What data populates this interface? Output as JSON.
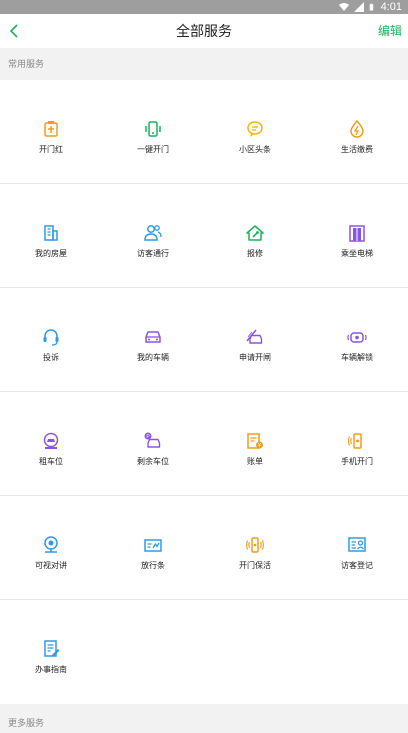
{
  "status_bar": {
    "time": "4:01"
  },
  "nav": {
    "title": "全部服务",
    "edit": "编辑"
  },
  "sections": {
    "common": "常用服务",
    "more": "更多服务"
  },
  "services": [
    {
      "label": "开门红",
      "icon": "gift-door-icon",
      "color": "#f39b1b"
    },
    {
      "label": "一键开门",
      "icon": "phone-door-icon",
      "color": "#19b35a"
    },
    {
      "label": "小区头条",
      "icon": "news-bubble-icon",
      "color": "#f5b400"
    },
    {
      "label": "生活缴费",
      "icon": "lightning-drop-icon",
      "color": "#f39b1b"
    },
    {
      "label": "我的房屋",
      "icon": "building-icon",
      "color": "#2e9be6"
    },
    {
      "label": "访客通行",
      "icon": "visitors-icon",
      "color": "#2e9be6"
    },
    {
      "label": "报修",
      "icon": "house-wrench-icon",
      "color": "#19b35a"
    },
    {
      "label": "乘坐电梯",
      "icon": "elevator-icon",
      "color": "#8a55e6"
    },
    {
      "label": "投诉",
      "icon": "headset-icon",
      "color": "#2e9be6"
    },
    {
      "label": "我的车辆",
      "icon": "car-icon",
      "color": "#8a55e6"
    },
    {
      "label": "申请开闸",
      "icon": "car-gate-icon",
      "color": "#8a55e6"
    },
    {
      "label": "车辆解锁",
      "icon": "car-unlock-icon",
      "color": "#8a55e6"
    },
    {
      "label": "租车位",
      "icon": "parking-rent-icon",
      "color": "#8a55e6"
    },
    {
      "label": "剩余车位",
      "icon": "parking-remaining-icon",
      "color": "#8a55e6"
    },
    {
      "label": "账单",
      "icon": "bill-icon",
      "color": "#f39b1b"
    },
    {
      "label": "手机开门",
      "icon": "phone-signal-icon",
      "color": "#f39b1b"
    },
    {
      "label": "可视对讲",
      "icon": "webcam-icon",
      "color": "#2e9be6"
    },
    {
      "label": "放行条",
      "icon": "pass-slip-icon",
      "color": "#2e9be6"
    },
    {
      "label": "开门保活",
      "icon": "phone-vibrate-icon",
      "color": "#f39b1b"
    },
    {
      "label": "访客登记",
      "icon": "visitor-register-icon",
      "color": "#2e9be6"
    },
    {
      "label": "办事指南",
      "icon": "guide-doc-icon",
      "color": "#2e9be6"
    }
  ]
}
